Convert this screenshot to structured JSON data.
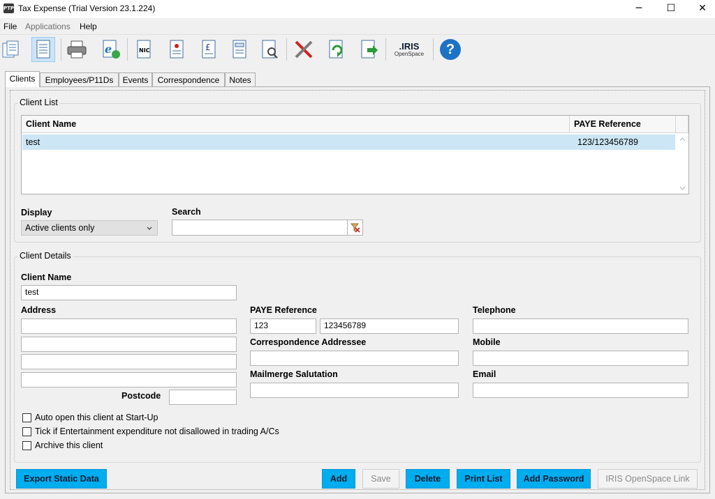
{
  "window": {
    "app_icon_text": "PTP",
    "title": "Tax Expense (Trial Version 23.1.224)",
    "min": "─",
    "max": "☐",
    "close": "✕"
  },
  "menu": [
    "File",
    "Applications",
    "Help"
  ],
  "toolbar": {
    "iris_brand": ".IRIS",
    "iris_sub": "OpenSpace",
    "help_glyph": "?",
    "icons": [
      "clients-icon",
      "document-icon",
      "print-icon",
      "internet-explorer-icon",
      "nic-icon",
      "report-icon",
      "pound-report-icon",
      "form-icon",
      "search-document-icon",
      "tools-icon",
      "refresh-icon",
      "export-icon",
      "iris-openspace-icon",
      "help-icon"
    ]
  },
  "tabs": [
    "Clients",
    "Employees/P11Ds",
    "Events",
    "Correspondence",
    "Notes"
  ],
  "client_list": {
    "title": "Client List",
    "columns": [
      "Client Name",
      "PAYE Reference"
    ],
    "rows": [
      [
        "test",
        "123/123456789"
      ]
    ],
    "display_label": "Display",
    "display_value": "Active clients only",
    "search_label": "Search",
    "search_value": ""
  },
  "details": {
    "title": "Client Details",
    "client_name_label": "Client Name",
    "client_name": "test",
    "address_label": "Address",
    "address_lines": [
      "",
      "",
      "",
      ""
    ],
    "postcode_label": "Postcode",
    "postcode": "",
    "paye_label": "PAYE Reference",
    "paye_office": "123",
    "paye_ref": "123456789",
    "corr_label": "Correspondence Addressee",
    "corr_value": "",
    "mailmerge_label": "Mailmerge Salutation",
    "mailmerge_value": "",
    "telephone_label": "Telephone",
    "telephone": "",
    "mobile_label": "Mobile",
    "mobile": "",
    "email_label": "Email",
    "email": "",
    "checkboxes": [
      {
        "label": "Auto open this client at Start-Up",
        "checked": false
      },
      {
        "label": "Tick if Entertainment expenditure not disallowed in trading A/Cs",
        "checked": false
      },
      {
        "label": "Archive this client",
        "checked": false
      }
    ]
  },
  "buttons": {
    "export": "Export Static Data",
    "add": "Add",
    "save": "Save",
    "delete": "Delete",
    "print_list": "Print List",
    "add_password": "Add Password",
    "iris_link": "IRIS OpenSpace Link"
  },
  "colors": {
    "accent": "#00adef",
    "selection": "#cce6f5",
    "help": "#1e72c6"
  }
}
